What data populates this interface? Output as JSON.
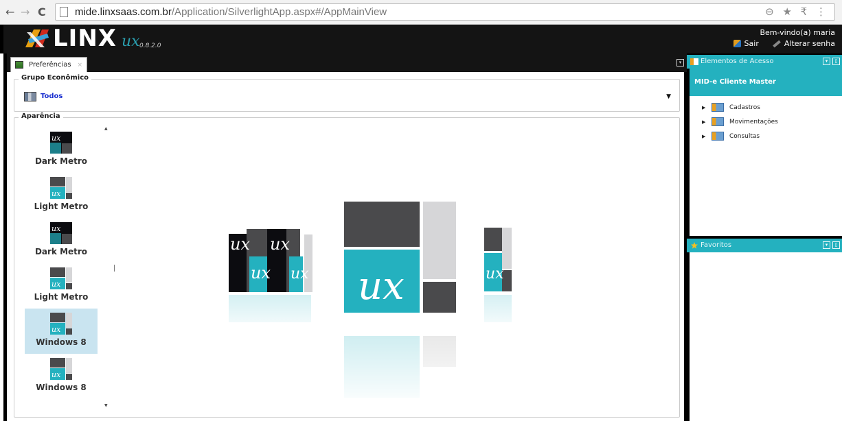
{
  "browser": {
    "nav_back": "←",
    "nav_forward": "→",
    "nav_reload": "C",
    "url_host": "mide.linxsaas.com.br",
    "url_path": "/Application/SilverlightApp.aspx#/AppMainView",
    "tools": "⊖ ★ ₹ ⋮"
  },
  "header": {
    "logo_text": "LINX",
    "logo_ux": "ux",
    "version": "0.8.2.0",
    "welcome": "Bem-vindo(a) maria",
    "logout_label": "Sair",
    "change_password_label": "Alterar senha"
  },
  "tabs": [
    {
      "label": "Preferências",
      "close": "×"
    }
  ],
  "tab_menu_icon": "▾",
  "main": {
    "group_legend": "Grupo Econômico",
    "group_value": "Todos",
    "group_caret": "▼",
    "appearance_legend": "Aparência",
    "scroll_up": "▲",
    "scroll_down": "▼",
    "themes": [
      {
        "label": "Dark Metro",
        "style": "dark"
      },
      {
        "label": "Light Metro",
        "style": "light"
      },
      {
        "label": "Dark Metro",
        "style": "dark"
      },
      {
        "label": "Light Metro",
        "style": "light"
      },
      {
        "label": "Windows 8",
        "style": "light",
        "selected": true
      },
      {
        "label": "Windows 8",
        "style": "light"
      }
    ],
    "preview_logo": "UX"
  },
  "access_panel": {
    "title": "Elementos de Acesso",
    "company": "MID-e Cliente Master",
    "items": [
      "Cadastros",
      "Movimentações",
      "Consultas"
    ]
  },
  "favorites_panel": {
    "title": "Favoritos"
  },
  "colors": {
    "accent": "#24b1bf",
    "header_bg": "#141414",
    "tile_dark": "#4a4a4c",
    "tile_light": "#d6d6d8"
  }
}
